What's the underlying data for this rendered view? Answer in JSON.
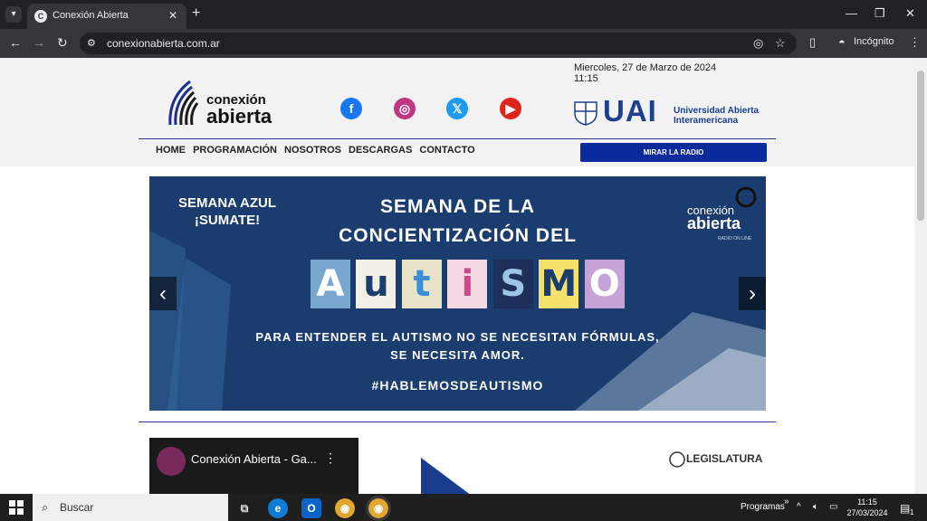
{
  "browser": {
    "tab_title": "Conexión Abierta",
    "url": "conexionabierta.com.ar",
    "incognito_label": "Incógnito"
  },
  "header": {
    "logo_line1": "conexión",
    "logo_line2": "abierta",
    "date": "Miercoles, 27 de Marzo de 2024",
    "time": "11:15",
    "uai_big": "UAI",
    "uai_line1": "Universidad Abierta",
    "uai_line2": "Interamericana"
  },
  "menu": {
    "items": [
      "HOME",
      "PROGRAMACIÓN",
      "NOSOTROS",
      "DESCARGAS",
      "CONTACTO"
    ],
    "radio_button": "MIRAR LA RADIO"
  },
  "banner": {
    "top_left_line1": "SEMANA AZUL",
    "top_left_line2": "¡SUMATE!",
    "title_line1": "SEMANA DE LA",
    "title_line2": "CONCIENTIZACIÓN DEL",
    "word_letters": [
      "A",
      "u",
      "t",
      "i",
      "S",
      "M",
      "O"
    ],
    "subtitle_line1": "PARA ENTENDER EL AUTISMO NO SE NECESITAN FÓRMULAS,",
    "subtitle_line2": "SE NECESITA AMOR.",
    "hashtag": "#HABLEMOSDEAUTISMO",
    "logo_line1": "conexión",
    "logo_line2": "abierta",
    "logo_tag": "RADIO ON LINE"
  },
  "cards": {
    "video_title": "Conexión Abierta - Ga...",
    "legislatura": "LEGISLATURA"
  },
  "taskbar": {
    "search_placeholder": "Buscar",
    "programs_label": "Programas",
    "clock_time": "11:15",
    "clock_date": "27/03/2024",
    "notification_count": "1"
  }
}
